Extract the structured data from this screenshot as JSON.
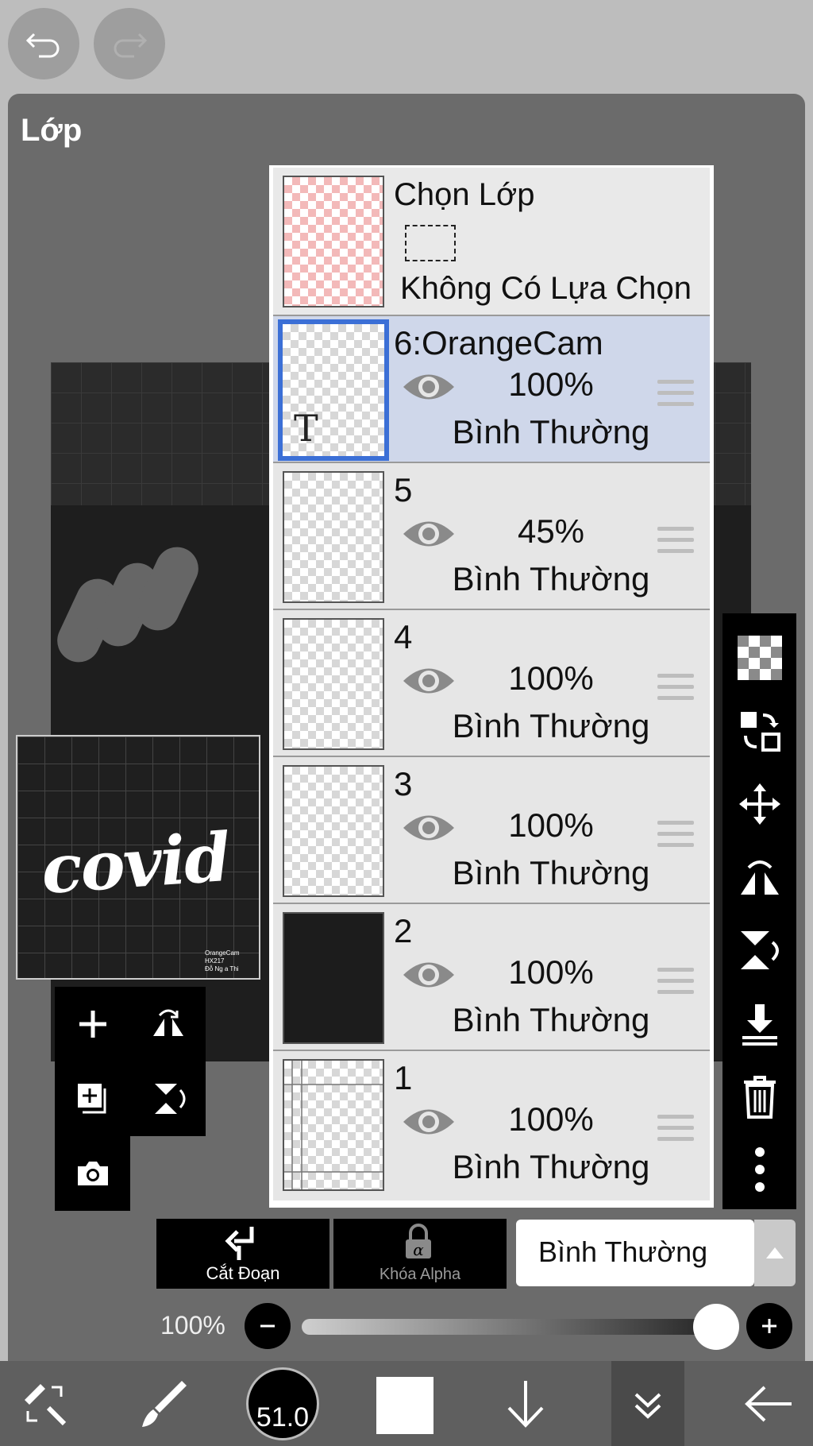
{
  "panel": {
    "title": "Lớp"
  },
  "preview": {
    "word": "covid",
    "small_lines": [
      "OrangeCam",
      "HX217",
      "Đỗ Ng a Thi"
    ]
  },
  "selection_layer": {
    "title": "Chọn Lớp",
    "status": "Không Có Lựa Chọn"
  },
  "layers": [
    {
      "name": "6:OrangeCam",
      "opacity": "100%",
      "blend": "Bình Thường",
      "active": true,
      "thumb": "text"
    },
    {
      "name": "5",
      "opacity": "45%",
      "blend": "Bình Thường",
      "active": false,
      "thumb": "blank"
    },
    {
      "name": "4",
      "opacity": "100%",
      "blend": "Bình Thường",
      "active": false,
      "thumb": "blank"
    },
    {
      "name": "3",
      "opacity": "100%",
      "blend": "Bình Thường",
      "active": false,
      "thumb": "blank"
    },
    {
      "name": "2",
      "opacity": "100%",
      "blend": "Bình Thường",
      "active": false,
      "thumb": "dark"
    },
    {
      "name": "1",
      "opacity": "100%",
      "blend": "Bình Thường",
      "active": false,
      "thumb": "lines"
    }
  ],
  "actions": {
    "clipping_label": "Cắt Đoạn",
    "alpha_lock_label": "Khóa Alpha"
  },
  "blend_mode": {
    "selected": "Bình Thường"
  },
  "opacity_slider": {
    "label": "100%",
    "value": 1.0
  },
  "toolbar": {
    "brush_size": "51.0"
  },
  "colors": {
    "accent_blue": "#3b6fd6",
    "active_row": "#cfd7ea",
    "panel_bg": "#6b6b6b"
  }
}
